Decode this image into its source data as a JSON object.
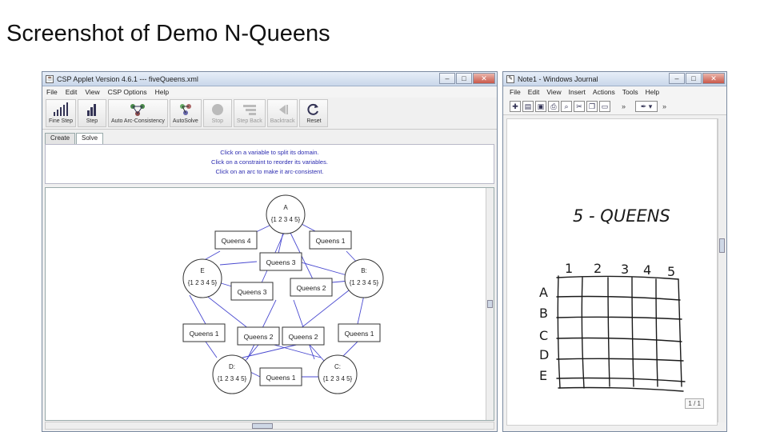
{
  "slide": {
    "title": "Screenshot of Demo N-Queens"
  },
  "csp": {
    "title": "CSP Applet Version 4.6.1 --- fiveQueens.xml",
    "menu": [
      "File",
      "Edit",
      "View",
      "CSP Options",
      "Help"
    ],
    "toolbar": [
      "Fine Step",
      "Step",
      "Auto Arc-Consistency",
      "AutoSolve",
      "Stop",
      "Step Back",
      "Backtrack",
      "Reset"
    ],
    "tabs": [
      "Create",
      "Solve"
    ],
    "messages": [
      "Click on a variable to split its domain.",
      "Click on a constraint to reorder its variables.",
      "Click on an arc to make it arc-consistent."
    ],
    "nodes": [
      {
        "name": "A",
        "domain": "{1 2 3 4 5}"
      },
      {
        "name": "B:",
        "domain": "{1 2 3 4 5}"
      },
      {
        "name": "C:",
        "domain": "{1 2 3 4 5}"
      },
      {
        "name": "D:",
        "domain": "{1 2 3 4 5}"
      },
      {
        "name": "E",
        "domain": "{1 2 3 4 5}"
      }
    ],
    "constraints": [
      "Queens 4",
      "Queens 1",
      "Queens 3",
      "Queens 3",
      "Queens 2",
      "Queens 1",
      "Queens 2",
      "Queens 2",
      "Queens 1",
      "Queens 1"
    ]
  },
  "journal": {
    "title": "Note1 - Windows Journal",
    "menu": [
      "File",
      "Edit",
      "View",
      "Insert",
      "Actions",
      "Tools",
      "Help"
    ],
    "heading": "5 - QUEENS",
    "columns": [
      "1",
      "2",
      "3",
      "4",
      "5"
    ],
    "rows": [
      "A",
      "B",
      "C",
      "D",
      "E"
    ],
    "page": "1 / 1"
  },
  "colors": {
    "edge": "#4a4ad0",
    "note_ink": "#1a1a1a",
    "msg_text": "#2b2bb0"
  }
}
